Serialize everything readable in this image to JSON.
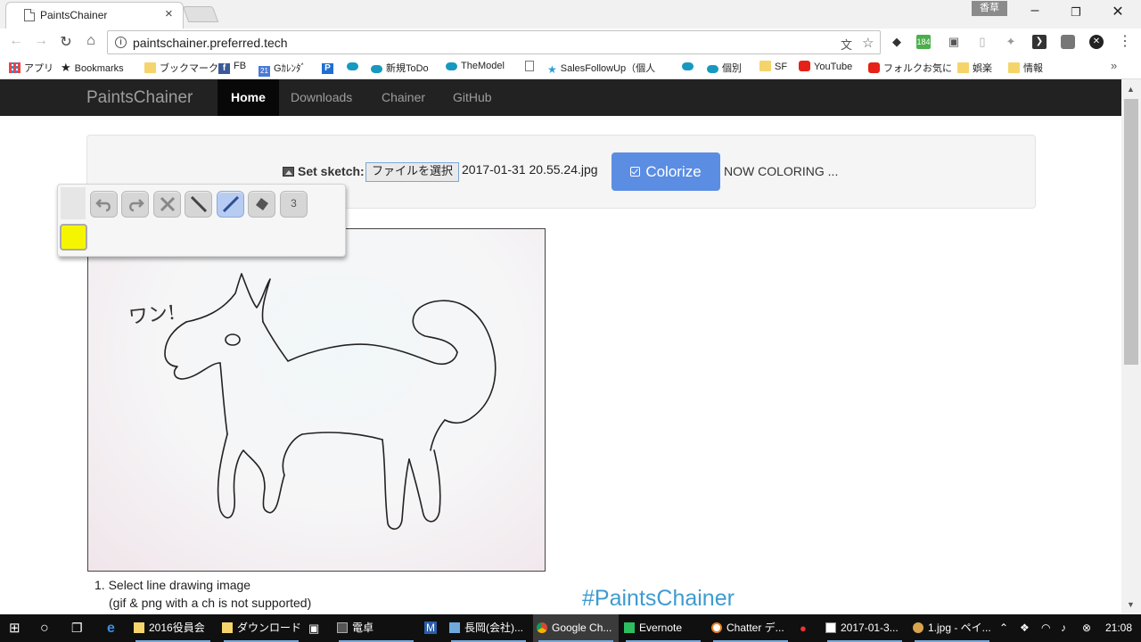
{
  "browser": {
    "tab_title": "PaintsChainer",
    "tab_close": "×",
    "ime_label": "香草",
    "url": "paintschainer.preferred.tech",
    "bookmarks": [
      {
        "label": "アプリ",
        "icon": "apps-grid-icon"
      },
      {
        "label": "Bookmarks",
        "icon": "star-icon"
      },
      {
        "label": "ブックマーク",
        "icon": "folder-icon"
      },
      {
        "label": "FB",
        "icon": "facebook-icon"
      },
      {
        "label": "Gｶﾚﾝﾀﾞ",
        "icon": "calendar-icon"
      },
      {
        "label": "",
        "icon": "p-icon"
      },
      {
        "label": "",
        "icon": "salesforce-cloud-icon"
      },
      {
        "label": "新規ToDo",
        "icon": "salesforce-cloud-icon"
      },
      {
        "label": "TheModel",
        "icon": "salesforce-cloud-icon"
      },
      {
        "label": "",
        "icon": "page-icon"
      },
      {
        "label": "SalesFollowUp（個人",
        "icon": "runner-icon"
      },
      {
        "label": "",
        "icon": "salesforce-cloud-icon"
      },
      {
        "label": "個別",
        "icon": "salesforce-cloud-icon"
      },
      {
        "label": "SF",
        "icon": "folder-icon"
      },
      {
        "label": "YouTube",
        "icon": "youtube-icon"
      },
      {
        "label": "フォルクお気に",
        "icon": "youtube-icon"
      },
      {
        "label": "娯楽",
        "icon": "folder-icon"
      },
      {
        "label": "情報",
        "icon": "folder-icon"
      }
    ],
    "bookmarks_more": "»",
    "extension_badge": "184"
  },
  "site": {
    "brand": "PaintsChainer",
    "nav": [
      "Home",
      "Downloads",
      "Chainer",
      "GitHub"
    ],
    "active_nav": "Home"
  },
  "panel": {
    "set_sketch_label": "Set sketch:",
    "file_button": "ファイルを選択",
    "file_name": "2017-01-31 20.55.24.jpg",
    "colorize_label": "Colorize",
    "status": "NOW COLORING ..."
  },
  "canvas": {
    "annotation": "ワン!"
  },
  "palette": {
    "tools": [
      "undo-icon",
      "redo-icon",
      "clear-icon",
      "pen-icon",
      "brush-icon",
      "eraser-icon"
    ],
    "active_tool": "brush-icon",
    "size_value": "3",
    "color": "#f5f500"
  },
  "steps": {
    "step1": "1. Select line drawing image",
    "step1_note": "(gif & png with a ch is not supported)"
  },
  "hashtag": "#PaintsChainer",
  "taskbar": {
    "items": [
      "2016役員会",
      "ダウンロード",
      "電卓",
      "長岡(会社)...",
      "Google Ch...",
      "Evernote",
      "Chatter デ...",
      "2017-01-3...",
      "1.jpg - ペイ..."
    ],
    "time": "21:08"
  }
}
